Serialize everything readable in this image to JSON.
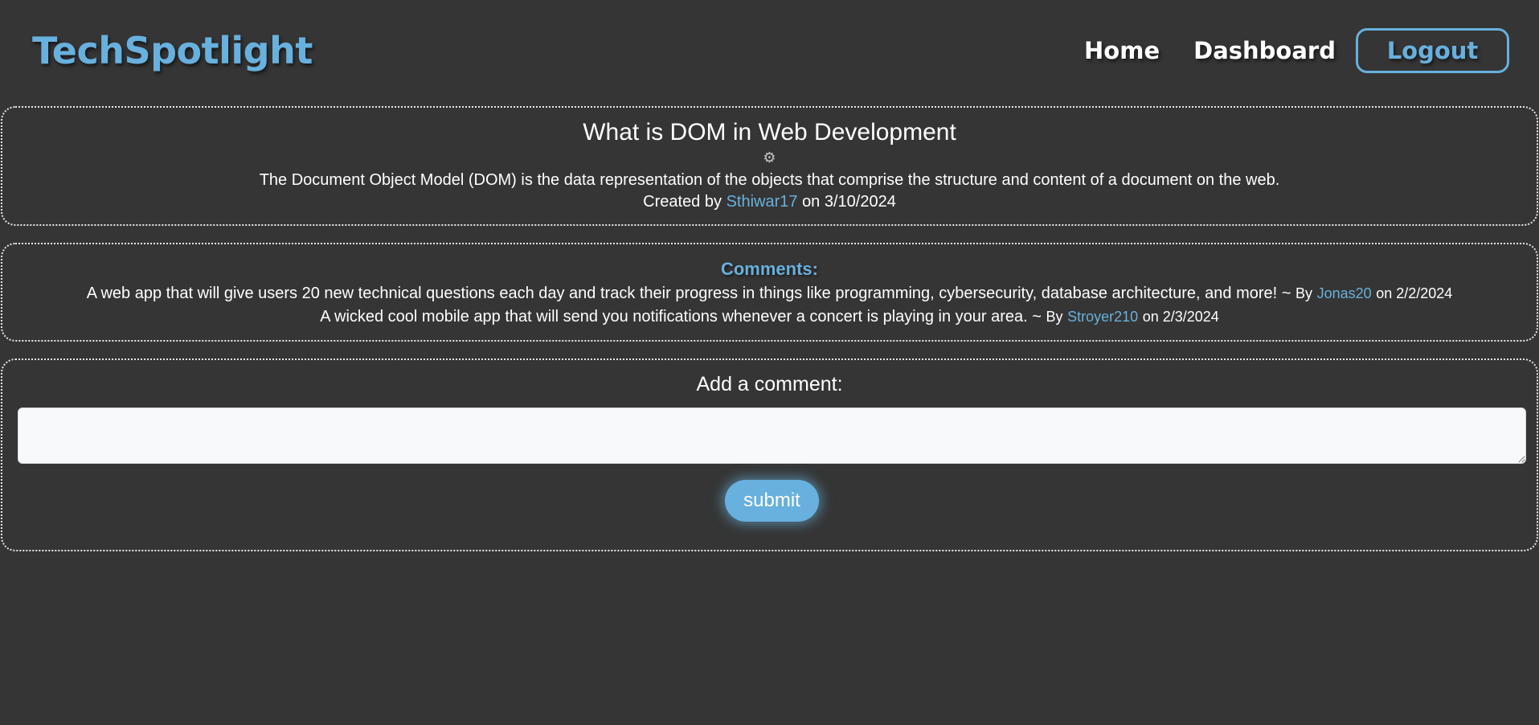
{
  "header": {
    "brand": "TechSpotlight",
    "nav": {
      "home": "Home",
      "dashboard": "Dashboard",
      "logout": "Logout"
    }
  },
  "post": {
    "title": "What is DOM in Web Development",
    "icon": "gear-icon",
    "body": "The Document Object Model (DOM) is the data representation of the objects that comprise the structure and content of a document on the web.",
    "created_prefix": "Created by",
    "author": "Sthiwar17",
    "date_text": "on 3/10/2024"
  },
  "comments": {
    "heading": "Comments:",
    "items": [
      {
        "text": "A web app that will give users 20 new technical questions each day and track their progress in things like programming, cybersecurity, database architecture, and more! ~",
        "by": "By",
        "user": "Jonas20",
        "date_text": "on 2/2/2024"
      },
      {
        "text": "A wicked cool mobile app that will send you notifications whenever a concert is playing in your area. ~",
        "by": "By",
        "user": "Stroyer210",
        "date_text": "on 2/3/2024"
      }
    ]
  },
  "add_comment": {
    "label": "Add a comment:",
    "value": "",
    "submit_label": "submit"
  },
  "colors": {
    "background": "#353535",
    "accent": "#68b0dd",
    "text": "#ffffff",
    "input_bg": "#f8f9fb"
  }
}
